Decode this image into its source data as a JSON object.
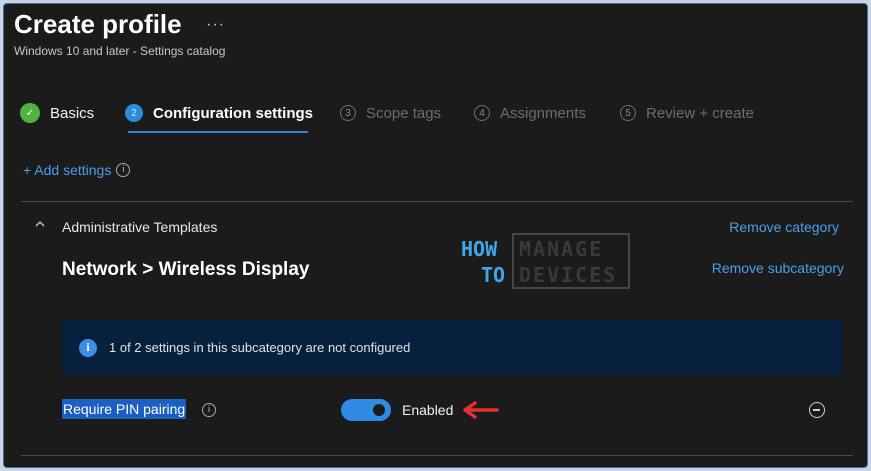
{
  "header": {
    "title": "Create profile",
    "menu_glyph": "···",
    "subtitle": "Windows 10 and later - Settings catalog"
  },
  "steps": [
    {
      "number": "✓",
      "label": "Basics",
      "state": "done"
    },
    {
      "number": "2",
      "label": "Configuration settings",
      "state": "active"
    },
    {
      "number": "3",
      "label": "Scope tags",
      "state": "pending"
    },
    {
      "number": "4",
      "label": "Assignments",
      "state": "pending"
    },
    {
      "number": "5",
      "label": "Review + create",
      "state": "pending"
    }
  ],
  "add_settings": {
    "label": "+ Add settings",
    "info_glyph": "i"
  },
  "category": {
    "title": "Administrative Templates",
    "remove_category_label": "Remove category",
    "subcategory_title": "Network > Wireless Display",
    "remove_subcategory_label": "Remove subcategory"
  },
  "logo": {
    "word1": "HOW",
    "word2": "TO",
    "word3": "MANAGE",
    "word4": "DEVICES"
  },
  "info_banner": {
    "icon_glyph": "i",
    "text": "1 of 2 settings in this subcategory are not configured"
  },
  "setting": {
    "label": "Require PIN pairing",
    "info_glyph": "i",
    "toggle_state": "on",
    "value_label": "Enabled"
  },
  "colors": {
    "accent": "#2f8ae6",
    "link": "#4aa0e8",
    "success": "#54b040",
    "banner_bg": "#07203d",
    "annotation_arrow": "#e53030"
  }
}
